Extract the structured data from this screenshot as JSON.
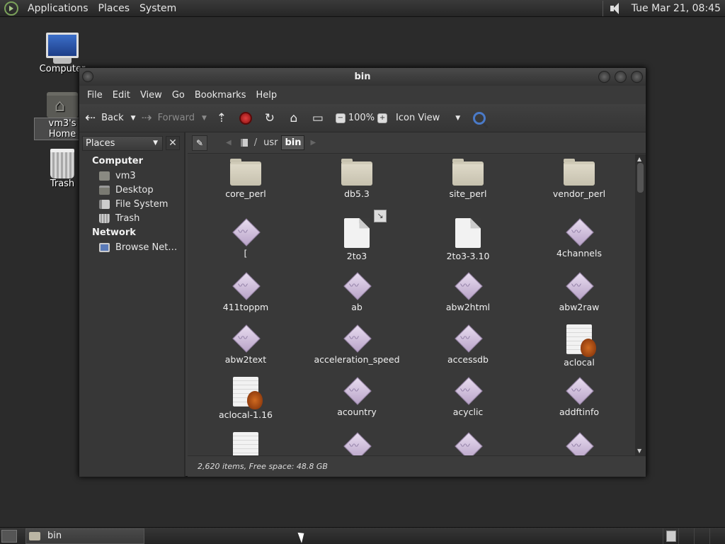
{
  "top_panel": {
    "menus": [
      "Applications",
      "Places",
      "System"
    ],
    "clock": "Tue Mar 21, 08:45"
  },
  "desktop": {
    "icons": [
      {
        "label": "Computer"
      },
      {
        "label": "vm3's Home"
      },
      {
        "label": "Trash"
      }
    ]
  },
  "window": {
    "title": "bin",
    "menubar": [
      "File",
      "Edit",
      "View",
      "Go",
      "Bookmarks",
      "Help"
    ],
    "toolbar": {
      "back": "Back",
      "forward": "Forward",
      "zoom": "100%",
      "view_mode": "Icon View"
    },
    "sidebar": {
      "combo": "Places",
      "sections": [
        {
          "title": "Computer",
          "items": [
            "vm3",
            "Desktop",
            "File System",
            "Trash"
          ]
        },
        {
          "title": "Network",
          "items": [
            "Browse Net…"
          ]
        }
      ]
    },
    "pathbar": [
      "usr",
      "bin"
    ],
    "files": [
      {
        "name": "core_perl",
        "icon": "folder"
      },
      {
        "name": "db5.3",
        "icon": "folder"
      },
      {
        "name": "site_perl",
        "icon": "folder"
      },
      {
        "name": "vendor_perl",
        "icon": "folder"
      },
      {
        "name": "[",
        "icon": "executable"
      },
      {
        "name": "2to3",
        "icon": "symlink-document"
      },
      {
        "name": "2to3-3.10",
        "icon": "document"
      },
      {
        "name": "4channels",
        "icon": "executable"
      },
      {
        "name": "411toppm",
        "icon": "executable"
      },
      {
        "name": "ab",
        "icon": "executable"
      },
      {
        "name": "abw2html",
        "icon": "executable"
      },
      {
        "name": "abw2raw",
        "icon": "executable"
      },
      {
        "name": "abw2text",
        "icon": "executable"
      },
      {
        "name": "acceleration_speed",
        "icon": "executable"
      },
      {
        "name": "accessdb",
        "icon": "executable"
      },
      {
        "name": "aclocal",
        "icon": "script"
      },
      {
        "name": "aclocal-1.16",
        "icon": "script"
      },
      {
        "name": "acountry",
        "icon": "executable"
      },
      {
        "name": "acyclic",
        "icon": "executable"
      },
      {
        "name": "addftinfo",
        "icon": "executable"
      }
    ],
    "status": "2,620 items, Free space: 48.8 GB"
  },
  "taskbar": {
    "task_label": "bin"
  }
}
